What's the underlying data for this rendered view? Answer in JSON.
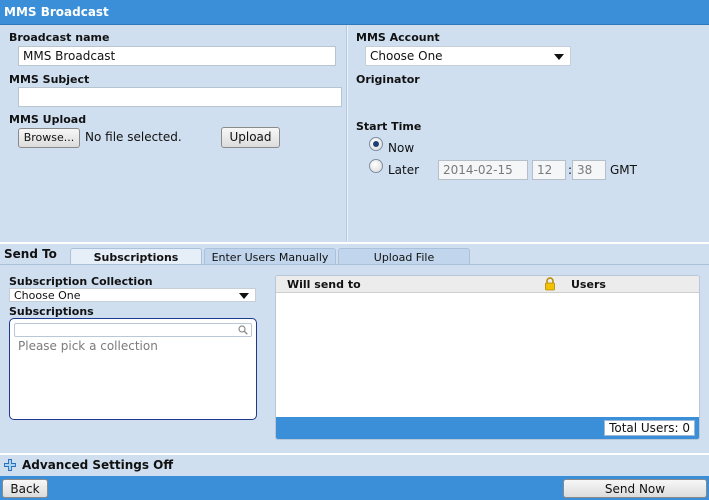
{
  "title": "MMS Broadcast",
  "form": {
    "broadcast_name_label": "Broadcast name",
    "broadcast_name_value": "MMS Broadcast",
    "subject_label": "MMS Subject",
    "subject_value": "",
    "upload_label": "MMS Upload",
    "browse_label": "Browse...",
    "file_status": "No file selected.",
    "upload_button": "Upload",
    "account_label": "MMS Account",
    "account_selected": "Choose One",
    "originator_label": "Originator",
    "start_time_label": "Start Time",
    "now_label": "Now",
    "later_label": "Later",
    "later_date": "2014-02-15",
    "later_hour": "12",
    "time_sep": ":",
    "later_minute": "38",
    "timezone": "GMT",
    "start_selected": "now"
  },
  "send_to": {
    "title": "Send To",
    "tabs": [
      {
        "label": "Subscriptions",
        "active": true
      },
      {
        "label": "Enter Users Manually",
        "active": false
      },
      {
        "label": "Upload File",
        "active": false
      }
    ],
    "collection_label": "Subscription Collection",
    "collection_selected": "Choose One",
    "subscriptions_label": "Subscriptions",
    "subscriptions_search": "",
    "subscriptions_placeholder": "Please pick a collection",
    "will_send_to_header": "Will send to",
    "users_header": "Users",
    "total_users": "Total Users: 0"
  },
  "advanced": {
    "label": "Advanced Settings Off"
  },
  "footer": {
    "back_label": "Back",
    "send_now_label": "Send Now"
  },
  "colors": {
    "header_blue": "#3a8fd8",
    "panel_bg": "#cfdff0",
    "accent_dark": "#1f3b8f"
  },
  "icons": {
    "dropdown": "chevron-down-icon",
    "search": "search-icon",
    "lock": "lock-icon",
    "expand": "plus-icon"
  }
}
